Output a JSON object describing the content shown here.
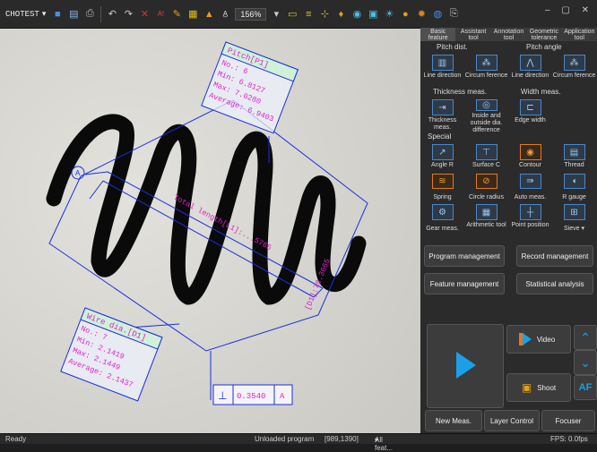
{
  "toolbar": {
    "brand": "CHOTEST",
    "brand_caret": "▾",
    "zoom": "156%",
    "window_controls": "– ▢ ✕"
  },
  "panel": {
    "tabs": [
      "Basic feature",
      "Assistant tool",
      "Annotation tool",
      "Geometric tolerance",
      "Application tool"
    ],
    "pitch_dist_title": "Pitch dist.",
    "pitch_angle_title": "Pitch angle",
    "thickness_title": "Thickness meas.",
    "width_title": "Width meas.",
    "special_title": "Special",
    "tools_row1": [
      "Line direction",
      "Circum ference",
      "Line direction",
      "Circum ference"
    ],
    "tools_row2": [
      "Thickness meas.",
      "Inside and outside dia. difference",
      "Edge width"
    ],
    "tools_row3": [
      "Angle R",
      "Surface C",
      "Contour",
      "Thread"
    ],
    "tools_row4": [
      "Spring",
      "Circle radius",
      "Auto meas.",
      "R gauge"
    ],
    "tools_row5": [
      "Gear meas.",
      "Arithmetic tool",
      "Point position",
      "Sieve"
    ],
    "sieve_caret": "▾",
    "program_management": "Program management",
    "record_management": "Record management",
    "feature_management": "Feature management",
    "statistical_analysis": "Statistical analysis",
    "video": "Video",
    "shoot": "Shoot",
    "af": "AF",
    "new_meas": "New Meas.",
    "layer_control": "Layer Control",
    "focuser": "Focuser"
  },
  "annotations": {
    "pitch_title": "Pitch[P1]",
    "pitch_no": "No.: 6",
    "pitch_min": "Min: 6.8127",
    "pitch_max": "Max: 7.0280",
    "pitch_avg": "Average: 6.9403",
    "total_length": "Total length[L1]:...5765",
    "side_label": "[D1]:78.3665",
    "wire_title": "Wire dia.[D1]",
    "wire_no": "No.: 7",
    "wire_min": "Min: 2.1419",
    "wire_max": "Max: 2.1449",
    "wire_avg": "Average: 2.1437",
    "datum_letter": "A",
    "tol_symbol": "⊥",
    "tol_value": "0.3540",
    "tol_datum": "A"
  },
  "status": {
    "ready": "Ready",
    "program": "Unloaded program",
    "coords": "[989,1390]",
    "features": "All feat...",
    "features_caret": "▾",
    "fps": "FPS: 0.0fps"
  },
  "colors": {
    "accent_blue": "#1aa0e8",
    "annotation_blue": "#1a2fe0",
    "annotation_magenta": "#e020d0",
    "panel_bg": "#2b2b2b"
  }
}
